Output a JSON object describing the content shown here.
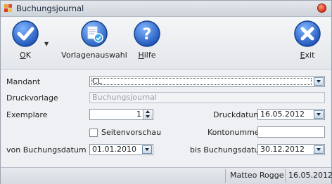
{
  "window": {
    "title": "Buchungsjournal"
  },
  "toolbar": {
    "ok": {
      "label_pre": "",
      "label_u": "O",
      "label_post": "K"
    },
    "vorlage": {
      "label": "Vorlagenauswahl"
    },
    "hilfe": {
      "label_pre": "",
      "label_u": "H",
      "label_post": "ilfe"
    },
    "exit": {
      "label_pre": "",
      "label_u": "E",
      "label_post": "xit"
    }
  },
  "form": {
    "mandant": {
      "label": "Mandant",
      "value": "CL"
    },
    "druckvorlage": {
      "label": "Druckvorlage",
      "value": "Buchungsjournal"
    },
    "exemplare": {
      "label": "Exemplare",
      "value": "1"
    },
    "druckdatum": {
      "label": "Druckdatum",
      "value": "16.05.2012"
    },
    "seitenvorschau": {
      "label": "Seitenvorschau",
      "checked": false
    },
    "kontonummer": {
      "label": "Kontonummer",
      "value": ""
    },
    "von_datum": {
      "label": "von Buchungsdatum",
      "value": "01.01.2010"
    },
    "bis_datum": {
      "label": "bis Buchungsdatum",
      "value": "30.12.2012"
    }
  },
  "status": {
    "user": "Matteo Rogge",
    "date": "16.05.2012"
  },
  "colors": {
    "accent": "#2f6fd0",
    "help": "#2f6fd0",
    "exit": "#2f6fd0",
    "close": "#d9381c"
  }
}
